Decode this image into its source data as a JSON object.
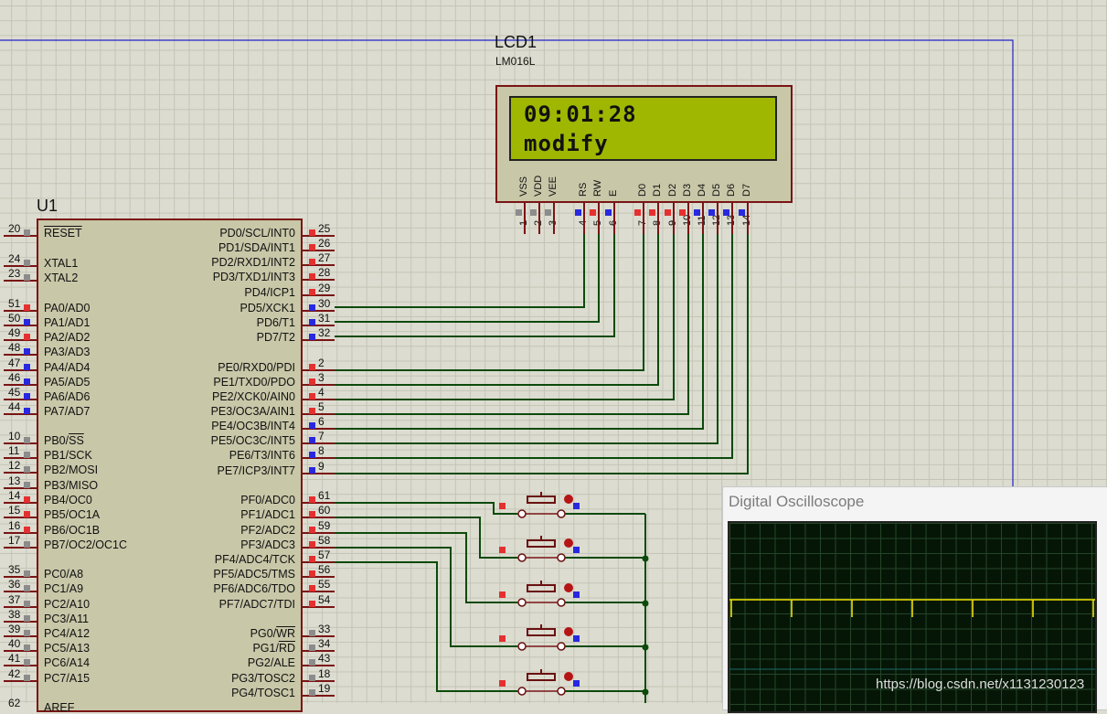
{
  "lcd": {
    "ref": "LCD1",
    "model": "LM016L",
    "line1": "09:01:28",
    "line2": "modify",
    "pins": [
      "VSS",
      "VDD",
      "VEE",
      "RS",
      "RW",
      "E",
      "D0",
      "D1",
      "D2",
      "D3",
      "D4",
      "D5",
      "D6",
      "D7"
    ],
    "pin_numbers": [
      "1",
      "2",
      "3",
      "4",
      "5",
      "6",
      "7",
      "8",
      "9",
      "10",
      "11",
      "12",
      "13",
      "14"
    ]
  },
  "mcu": {
    "ref": "U1",
    "left_pins": [
      {
        "num": "20",
        "name": "RESET"
      },
      {
        "num": "24",
        "name": "XTAL1"
      },
      {
        "num": "23",
        "name": "XTAL2"
      },
      {
        "num": "51",
        "name": "PA0/AD0"
      },
      {
        "num": "50",
        "name": "PA1/AD1"
      },
      {
        "num": "49",
        "name": "PA2/AD2"
      },
      {
        "num": "48",
        "name": "PA3/AD3"
      },
      {
        "num": "47",
        "name": "PA4/AD4"
      },
      {
        "num": "46",
        "name": "PA5/AD5"
      },
      {
        "num": "45",
        "name": "PA6/AD6"
      },
      {
        "num": "44",
        "name": "PA7/AD7"
      },
      {
        "num": "10",
        "name": "PB0/SS"
      },
      {
        "num": "11",
        "name": "PB1/SCK"
      },
      {
        "num": "12",
        "name": "PB2/MOSI"
      },
      {
        "num": "13",
        "name": "PB3/MISO"
      },
      {
        "num": "14",
        "name": "PB4/OC0"
      },
      {
        "num": "15",
        "name": "PB5/OC1A"
      },
      {
        "num": "16",
        "name": "PB6/OC1B"
      },
      {
        "num": "17",
        "name": "PB7/OC2/OC1C"
      },
      {
        "num": "35",
        "name": "PC0/A8"
      },
      {
        "num": "36",
        "name": "PC1/A9"
      },
      {
        "num": "37",
        "name": "PC2/A10"
      },
      {
        "num": "38",
        "name": "PC3/A11"
      },
      {
        "num": "39",
        "name": "PC4/A12"
      },
      {
        "num": "40",
        "name": "PC5/A13"
      },
      {
        "num": "41",
        "name": "PC6/A14"
      },
      {
        "num": "42",
        "name": "PC7/A15"
      },
      {
        "num": "62",
        "name": "AREF"
      }
    ],
    "right_pins": [
      {
        "num": "25",
        "name": "PD0/SCL/INT0"
      },
      {
        "num": "26",
        "name": "PD1/SDA/INT1"
      },
      {
        "num": "27",
        "name": "PD2/RXD1/INT2"
      },
      {
        "num": "28",
        "name": "PD3/TXD1/INT3"
      },
      {
        "num": "29",
        "name": "PD4/ICP1"
      },
      {
        "num": "30",
        "name": "PD5/XCK1"
      },
      {
        "num": "31",
        "name": "PD6/T1"
      },
      {
        "num": "32",
        "name": "PD7/T2"
      },
      {
        "num": "2",
        "name": "PE0/RXD0/PDI"
      },
      {
        "num": "3",
        "name": "PE1/TXD0/PDO"
      },
      {
        "num": "4",
        "name": "PE2/XCK0/AIN0"
      },
      {
        "num": "5",
        "name": "PE3/OC3A/AIN1"
      },
      {
        "num": "6",
        "name": "PE4/OC3B/INT4"
      },
      {
        "num": "7",
        "name": "PE5/OC3C/INT5"
      },
      {
        "num": "8",
        "name": "PE6/T3/INT6"
      },
      {
        "num": "9",
        "name": "PE7/ICP3/INT7"
      },
      {
        "num": "61",
        "name": "PF0/ADC0"
      },
      {
        "num": "60",
        "name": "PF1/ADC1"
      },
      {
        "num": "59",
        "name": "PF2/ADC2"
      },
      {
        "num": "58",
        "name": "PF3/ADC3"
      },
      {
        "num": "57",
        "name": "PF4/ADC4/TCK"
      },
      {
        "num": "56",
        "name": "PF5/ADC5/TMS"
      },
      {
        "num": "55",
        "name": "PF6/ADC6/TDO"
      },
      {
        "num": "54",
        "name": "PF7/ADC7/TDI"
      },
      {
        "num": "33",
        "name": "PG0/WR"
      },
      {
        "num": "34",
        "name": "PG1/RD"
      },
      {
        "num": "43",
        "name": "PG2/ALE"
      },
      {
        "num": "18",
        "name": "PG3/TOSC2"
      },
      {
        "num": "19",
        "name": "PG4/TOSC1"
      }
    ]
  },
  "scope": {
    "title": "Digital Oscilloscope"
  },
  "watermark": "https://blog.csdn.net/x1131230123",
  "colors": {
    "wire": "#0b4a0b",
    "pin_high": "#e53030",
    "pin_low": "#2828e0",
    "pin_na": "#8c8c8c",
    "lcd_bg": "#9fb700",
    "border": "#7a1414",
    "trace": "#f0e000"
  }
}
